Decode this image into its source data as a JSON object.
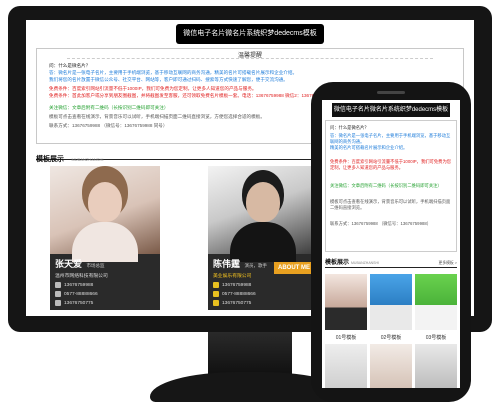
{
  "desktop": {
    "title": "微信电子名片微名片系统织梦dedecms模板",
    "notice": {
      "heading": "温馨提醒",
      "q": "问：什么是微名片？",
      "a1": "答：微名片是一张电子名片，主要用于手机端浏览，基于移动互联网的商务沟通，精美的名片可搭载名片展示和企业介绍。",
      "a2": "我们将您的名片放置于微信公众号、社交平台、网站等，客户即可通过扫码、搜索等方式快速了解您，便于交流沟通。",
      "a3": "免费条件：百度索引网站引流量不低于1000IP，我们可免费为您定制，让更多人知道您的产品与服务。",
      "a4": "免费条件：首此加客户或分享到朋友圈截图，并将截图发至客服，还可领取免费名片模板一套。电话：13676759988 微信2：13676759988 加微信免费咨询。",
      "a5": "关注微信：文章后附有二维码（长按识别二维码即可关注）",
      "a6": "模板可点击查看在线演示，背景音乐可以试听，手机端扫描页面二维码直接浏览，方便您选择合适的模板。",
      "a7": "联系方式：13676759988 （微信号：13676759988 同号）"
    },
    "section": {
      "title": "模板展示",
      "subtitle": "MUBANZHANSHI"
    },
    "cards": [
      {
        "name": "张天爱",
        "role": "市场总监",
        "company": "温州市网络科技有限公司",
        "phone": "13676759988",
        "tel": "0577-88888666",
        "wechat": "13676750775"
      },
      {
        "name": "陈伟霆",
        "role": "演员，歌手",
        "company": "美业娱乐有限公司",
        "phone": "13676759988",
        "tel": "0577-88888666",
        "wechat": "13676750775",
        "badge": "ABOUT ME"
      }
    ]
  },
  "phone": {
    "title": "微信电子名片微名片系统织梦dedecms模板",
    "notice": {
      "q": "问：什么是微名片？",
      "a1": "答：微名片是一张电子名片，主要用于手机端浏览，基于移动互联网的商务沟通。",
      "a2": "精美的名片可搭载名片展示和企业介绍。",
      "a3": "免费条件：百度索引网站引流量不低于1000IP，我们可免费为您定制，让更多人知道您的产品与服务。",
      "a4": "关注微信：文章后附有二维码（长按识别二维码即可关注）",
      "a5": "模板可点击查看在线演示，背景音乐可以试听，手机端扫描页面二维码直接浏览。",
      "a6": "联系方式：13676759988 （微信号：13676759988）"
    },
    "section": {
      "title": "模板展示",
      "subtitle": "MUBANZHANSHI",
      "more": "更多模板 >"
    },
    "tile_labels": [
      "01号模板",
      "02号模板",
      "03号模板"
    ]
  }
}
